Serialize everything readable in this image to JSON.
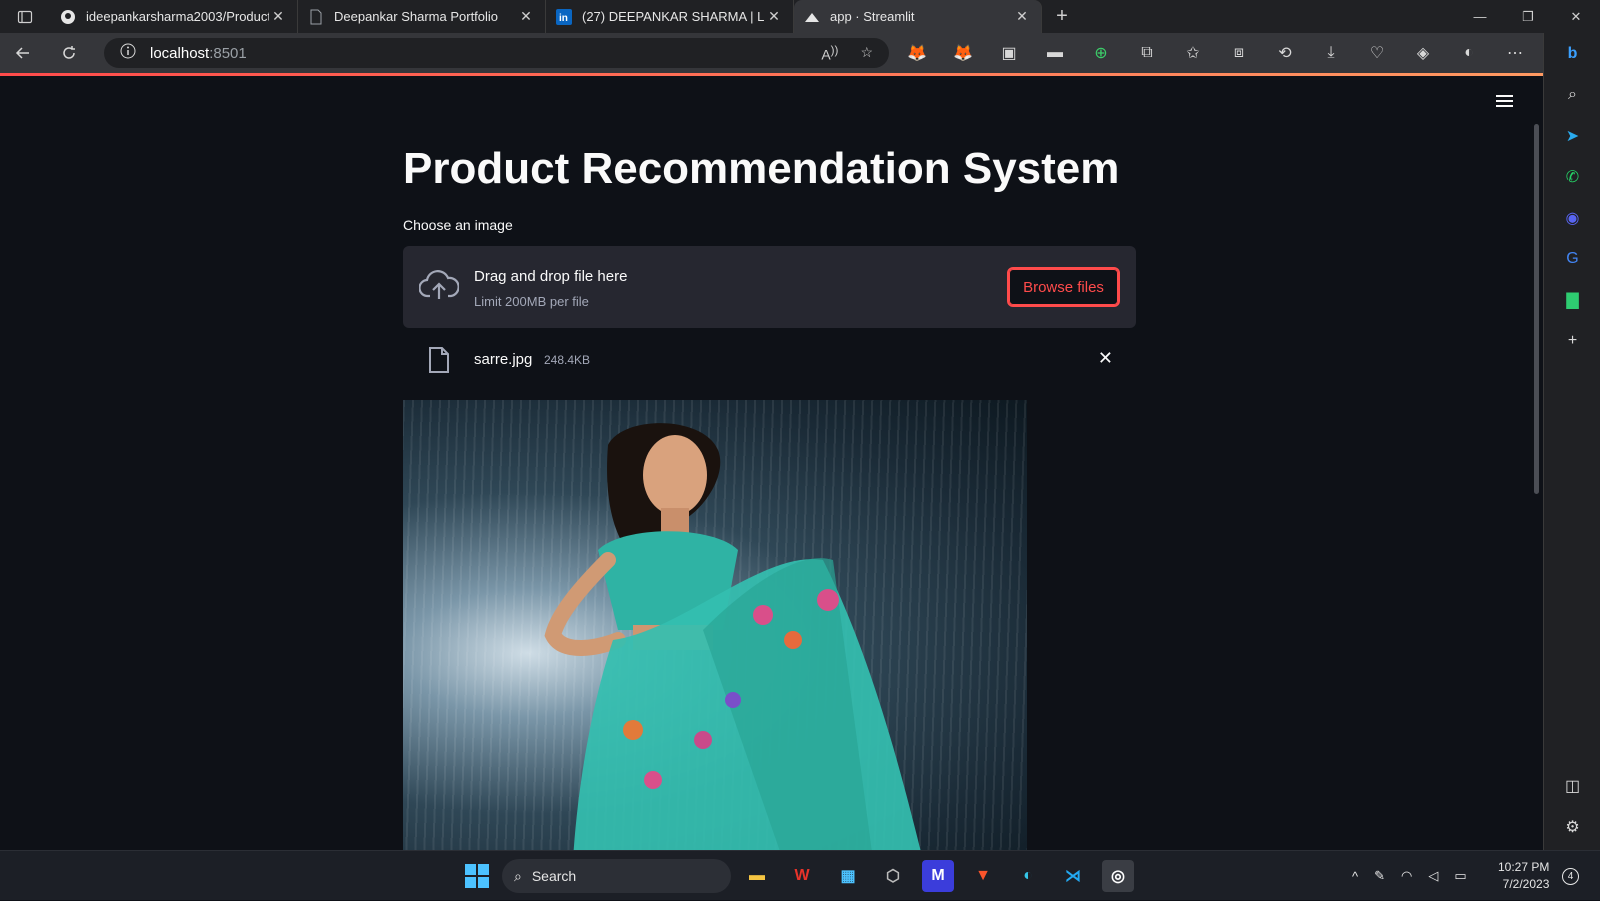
{
  "browser": {
    "tabs": [
      {
        "title": "ideepankarsharma2003/Product",
        "icon": "github-icon"
      },
      {
        "title": "Deepankar Sharma Portfolio",
        "icon": "page-icon"
      },
      {
        "title": "(27) DEEPANKAR SHARMA | Link",
        "icon": "linkedin-icon"
      },
      {
        "title": "app · Streamlit",
        "icon": "streamlit-icon",
        "active": true
      }
    ],
    "url_host": "localhost",
    "url_port": ":8501"
  },
  "app": {
    "title": "Product Recommendation System",
    "uploader_label": "Choose an image",
    "dropzone_main": "Drag and drop file here",
    "dropzone_sub": "Limit 200MB per file",
    "browse_label": "Browse files",
    "file_name": "sarre.jpg",
    "file_size": "248.4KB"
  },
  "taskbar": {
    "search_label": "Search",
    "time": "10:27 PM",
    "date": "7/2/2023",
    "notification_count": "4"
  },
  "colors": {
    "accent": "#ff4b4b",
    "background": "#0e1117",
    "dropzone": "#262730"
  }
}
